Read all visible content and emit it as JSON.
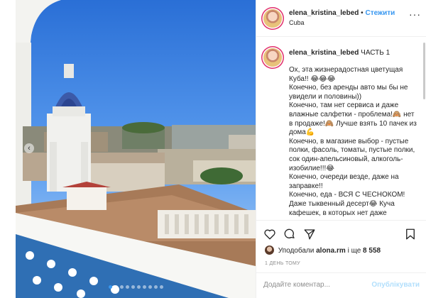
{
  "post": {
    "username": "elena_kristina_lebed",
    "separator": "•",
    "follow_label": "Стежити",
    "location": "Cuba",
    "more_label": "···",
    "caption_lines": [
      "Ох, эта жизнерадостная цветущая Куба!! 😂😂😂",
      "Конечно, без аренды авто мы бы не увидели и половины))",
      "Конечно, там нет сервиса и даже влажные салфетки - проблема!🙈 нет в продаже!🙈 Лучше взять 10 пачек из дома💪",
      "Конечно, в магазине выбор - пустые полки, фасоль, томаты, пустые полки, сок один-апельсиновый, алкоголь- изобилие!!!😂",
      "Конечно, очереди везде, даже на заправке!!",
      "Конечно, еда - ВСЯ С ЧЕСНОКОМ! Даже тыквенный десерт😂 Куча кафешек, в которых нет даже"
    ],
    "caption_title": "ЧАСТЬ 1",
    "likes_prefix": "Уподобали",
    "likes_user": "alona.rm",
    "likes_middle": "і ще",
    "likes_count": "8 558",
    "timestamp": "1 ДЕНЬ ТОМУ",
    "comment_placeholder": "Додайте коментар...",
    "publish_label": "Опублікувати"
  },
  "carousel": {
    "active_index": 0,
    "total": 10
  },
  "icons": [
    "heart-icon",
    "comment-icon",
    "share-icon",
    "save-icon",
    "chevron-left-icon",
    "more-icon"
  ],
  "colors": {
    "accent": "#3897f0",
    "text": "#262626",
    "muted": "#8e8e8e",
    "publish_disabled": "#b2dffc"
  }
}
